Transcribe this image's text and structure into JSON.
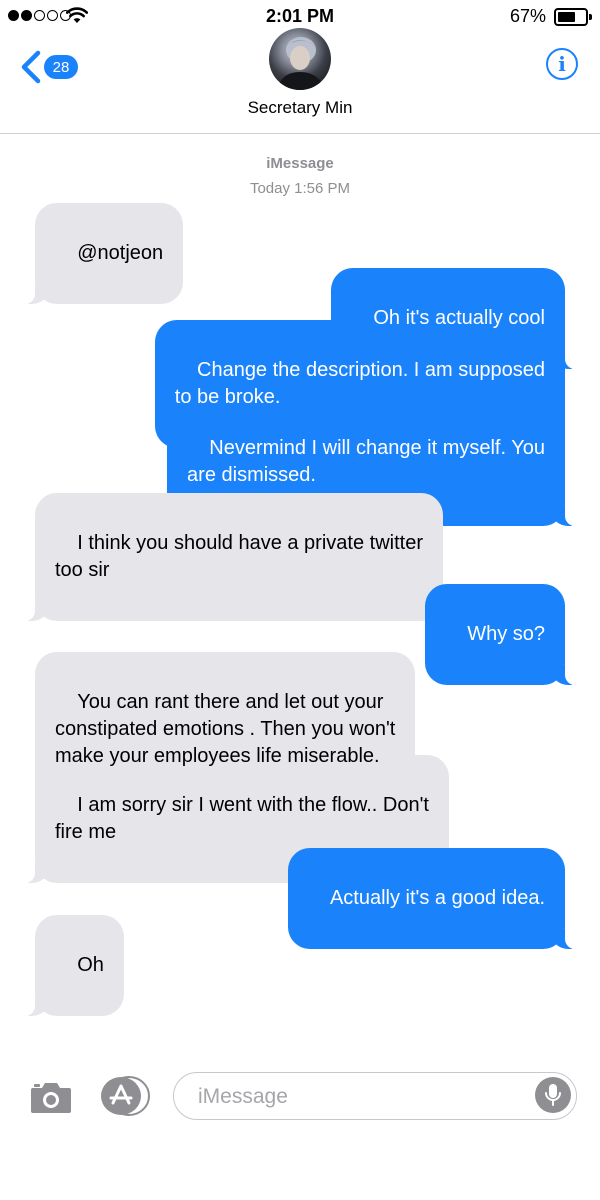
{
  "status_bar": {
    "time": "2:01 PM",
    "battery_percent": "67%",
    "battery_level": 0.67,
    "signal_bars": 2,
    "signal_total": 5
  },
  "header": {
    "back_badge": "28",
    "contact_name": "Secretary Min",
    "info_icon": "i"
  },
  "conversation": {
    "service": "iMessage",
    "timestamp": "Today 1:56 PM",
    "messages": [
      {
        "from": "them",
        "text": "@notjeon"
      },
      {
        "from": "me",
        "text": "Oh it's actually cool"
      },
      {
        "from": "me",
        "text": "Change the description. I am supposed\nto be broke."
      },
      {
        "from": "me",
        "text": "Nevermind I will change it myself. You\nare dismissed."
      },
      {
        "from": "them",
        "text": "I think you should have a private twitter\ntoo sir"
      },
      {
        "from": "me",
        "text": "Why so?"
      },
      {
        "from": "them",
        "text": "You can rant there and let out your\nconstipated emotions . Then you won't\nmake your employees life miserable."
      },
      {
        "from": "them",
        "text": "I am sorry sir I went with the flow.. Don't\nfire me"
      },
      {
        "from": "me",
        "text": "Actually it's a good idea."
      },
      {
        "from": "them",
        "text": "Oh"
      }
    ]
  },
  "input_bar": {
    "placeholder": "iMessage",
    "value": ""
  },
  "colors": {
    "accent": "#1a82fb",
    "incoming_bubble": "#e5e5ea",
    "secondary_text": "#8e8e93"
  },
  "icons": {
    "back": "chevron-left-icon",
    "info": "info-icon",
    "camera": "camera-icon",
    "apps": "app-store-icon",
    "mic": "microphone-icon",
    "wifi": "wifi-icon",
    "battery": "battery-icon"
  }
}
